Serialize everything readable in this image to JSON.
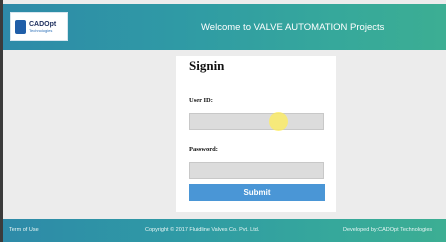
{
  "header": {
    "logo": {
      "name": "CADOpt",
      "tagline": "Technologies"
    },
    "title": "Welcome to VALVE AUTOMATION Projects"
  },
  "signin": {
    "title": "Signin",
    "user_id_label": "User ID:",
    "user_id_value": "",
    "password_label": "Password:",
    "password_value": "",
    "submit_label": "Submit"
  },
  "footer": {
    "terms": "Term of Use",
    "copyright": "Copyright © 2017 Fluidline Valves Co. Pvt. Ltd.",
    "developer": "Developed by:CADOpt Technologies"
  },
  "colors": {
    "header_gradient_start": "#2e8aa8",
    "header_gradient_end": "#3cae93",
    "submit_button": "#4a96d6",
    "page_background": "#ececec"
  },
  "icons": {
    "logo": "cadopt-logo",
    "cursor": "cursor-highlight"
  }
}
